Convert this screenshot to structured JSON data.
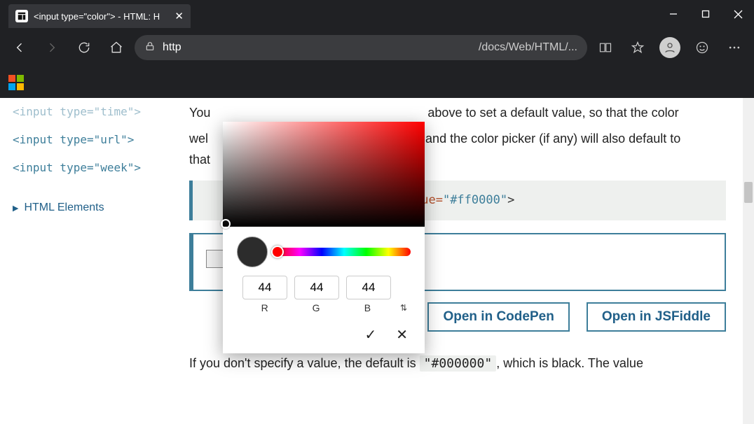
{
  "tab": {
    "title": "<input type=\"color\"> - HTML: H"
  },
  "url": {
    "prefix": "http",
    "path": "/docs/Web/HTML/..."
  },
  "sidebar": {
    "items": [
      "<input type=\"time\">",
      "<input type=\"url\">",
      "<input type=\"week\">"
    ],
    "section": "HTML Elements"
  },
  "content": {
    "p1_pre": "You",
    "p1_mid": "above to set a default value, so that the color",
    "p2_pre": "wel",
    "p2_mid": "and the color picker (if any) will also default to",
    "p2_end": "that",
    "code_end": "lue=",
    "code_val": "\"#ff0000\"",
    "code_close": ">",
    "open_codepen": "Open in CodePen",
    "open_jsfiddle": "Open in JSFiddle",
    "p3_a": "If you don't specify a value, the default is ",
    "p3_code": "\"#000000\"",
    "p3_b": ", which is black. The value"
  },
  "picker": {
    "r": "44",
    "g": "44",
    "b": "44",
    "labels": {
      "r": "R",
      "g": "G",
      "b": "B"
    }
  }
}
